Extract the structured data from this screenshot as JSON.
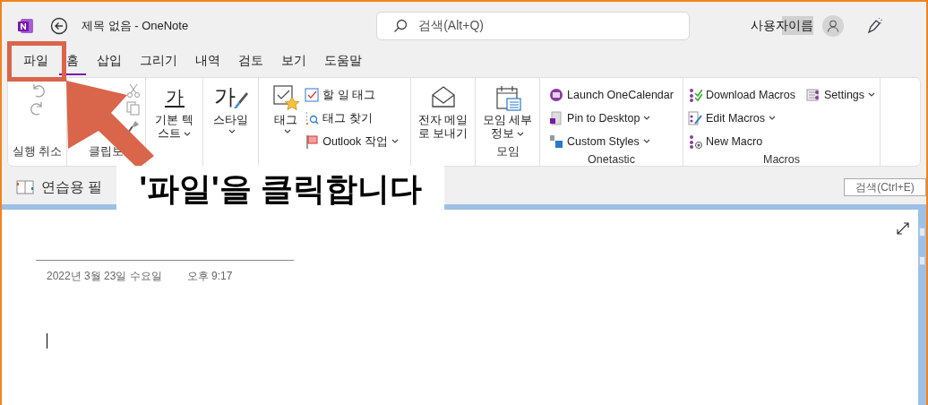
{
  "window": {
    "title": "제목 없음 - OneNote"
  },
  "search": {
    "placeholder": "검색(Alt+Q)"
  },
  "account": {
    "user_name": "사용자이름"
  },
  "tabs": [
    {
      "label": "파일",
      "selected": false
    },
    {
      "label": "홈",
      "selected": true
    },
    {
      "label": "삽입",
      "selected": false
    },
    {
      "label": "그리기",
      "selected": false
    },
    {
      "label": "내역",
      "selected": false
    },
    {
      "label": "검토",
      "selected": false
    },
    {
      "label": "보기",
      "selected": false
    },
    {
      "label": "도움말",
      "selected": false
    }
  ],
  "ribbon": {
    "groups": [
      {
        "label": "실행 취소"
      },
      {
        "label": "클립보"
      },
      {
        "large": [
          {
            "label": "기본 텍스트",
            "dropdown": true,
            "icon_text": "가"
          }
        ]
      },
      {
        "large": [
          {
            "label": "스타일",
            "dropdown": true,
            "icon_text": "가"
          }
        ]
      },
      {
        "large": [
          {
            "label": "태그",
            "dropdown": true
          }
        ],
        "small": [
          {
            "label": "할 일 태그",
            "dropdown": false
          },
          {
            "label": "태그 찾기",
            "dropdown": false
          },
          {
            "label": "Outlook 작업",
            "dropdown": true
          }
        ]
      },
      {
        "large": [
          {
            "label": "전자 메일로 보내기",
            "dropdown": false
          }
        ]
      },
      {
        "label": "모임",
        "large": [
          {
            "label": "모임 세부 정보",
            "dropdown": true
          }
        ]
      },
      {
        "label": "Onetastic",
        "small": [
          {
            "label": "Launch OneCalendar",
            "dropdown": false
          },
          {
            "label": "Pin to Desktop",
            "dropdown": true
          },
          {
            "label": "Custom Styles",
            "dropdown": true
          }
        ]
      },
      {
        "label": "Macros",
        "small": [
          {
            "label": "Download Macros",
            "dropdown": false
          },
          {
            "label": "Edit Macros",
            "dropdown": true
          },
          {
            "label": "New Macro",
            "dropdown": false
          },
          {
            "label": "Settings",
            "dropdown": true
          }
        ]
      }
    ]
  },
  "section_bar": {
    "section": "연습용 필",
    "search_placeholder": "검색(Ctrl+E)"
  },
  "page": {
    "date": "2022년 3월 23일 수요일",
    "time": "오후 9:17"
  },
  "annotation": {
    "caption": "'파일'을 클릭합니다"
  }
}
